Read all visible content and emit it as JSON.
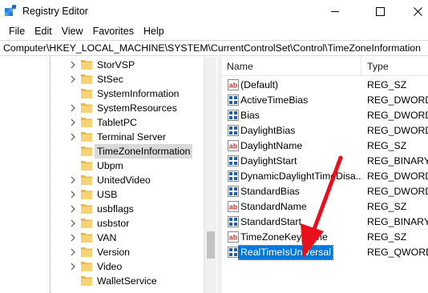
{
  "window": {
    "title": "Registry Editor",
    "controls": {
      "minimize": "minimize",
      "maximize": "maximize",
      "close": "close"
    }
  },
  "menu": [
    "File",
    "Edit",
    "View",
    "Favorites",
    "Help"
  ],
  "address": "Computer\\HKEY_LOCAL_MACHINE\\SYSTEM\\CurrentControlSet\\Control\\TimeZoneInformation",
  "tree": {
    "items": [
      {
        "label": "StorVSP",
        "expandable": true
      },
      {
        "label": "StSec",
        "expandable": true
      },
      {
        "label": "SystemInformation",
        "expandable": false
      },
      {
        "label": "SystemResources",
        "expandable": true
      },
      {
        "label": "TabletPC",
        "expandable": true
      },
      {
        "label": "Terminal Server",
        "expandable": true
      },
      {
        "label": "TimeZoneInformation",
        "expandable": false,
        "selected": true
      },
      {
        "label": "Ubpm",
        "expandable": false
      },
      {
        "label": "UnitedVideo",
        "expandable": true
      },
      {
        "label": "USB",
        "expandable": true
      },
      {
        "label": "usbflags",
        "expandable": true
      },
      {
        "label": "usbstor",
        "expandable": true
      },
      {
        "label": "VAN",
        "expandable": true
      },
      {
        "label": "Version",
        "expandable": true
      },
      {
        "label": "Video",
        "expandable": true
      },
      {
        "label": "WalletService",
        "expandable": false
      }
    ]
  },
  "list": {
    "columns": {
      "name": "Name",
      "type": "Type"
    },
    "rows": [
      {
        "name": "(Default)",
        "type": "REG_SZ",
        "icon": "string-value-icon"
      },
      {
        "name": "ActiveTimeBias",
        "type": "REG_DWORD",
        "icon": "binary-value-icon"
      },
      {
        "name": "Bias",
        "type": "REG_DWORD",
        "icon": "binary-value-icon"
      },
      {
        "name": "DaylightBias",
        "type": "REG_DWORD",
        "icon": "binary-value-icon"
      },
      {
        "name": "DaylightName",
        "type": "REG_SZ",
        "icon": "string-value-icon"
      },
      {
        "name": "DaylightStart",
        "type": "REG_BINARY",
        "icon": "binary-value-icon"
      },
      {
        "name": "DynamicDaylightTimeDisa...",
        "type": "REG_DWORD",
        "icon": "binary-value-icon"
      },
      {
        "name": "StandardBias",
        "type": "REG_DWORD",
        "icon": "binary-value-icon"
      },
      {
        "name": "StandardName",
        "type": "REG_SZ",
        "icon": "string-value-icon"
      },
      {
        "name": "StandardStart",
        "type": "REG_BINARY",
        "icon": "binary-value-icon"
      },
      {
        "name": "TimeZoneKeyName",
        "type": "REG_SZ",
        "icon": "string-value-icon"
      },
      {
        "name": "RealTimeIsUniversal",
        "type": "REG_QWORD",
        "icon": "binary-value-icon",
        "selected": true
      }
    ]
  },
  "colors": {
    "selection": "#0078d7",
    "annotation_arrow": "#e8101a",
    "tree_selection": "#d9d9d9"
  }
}
